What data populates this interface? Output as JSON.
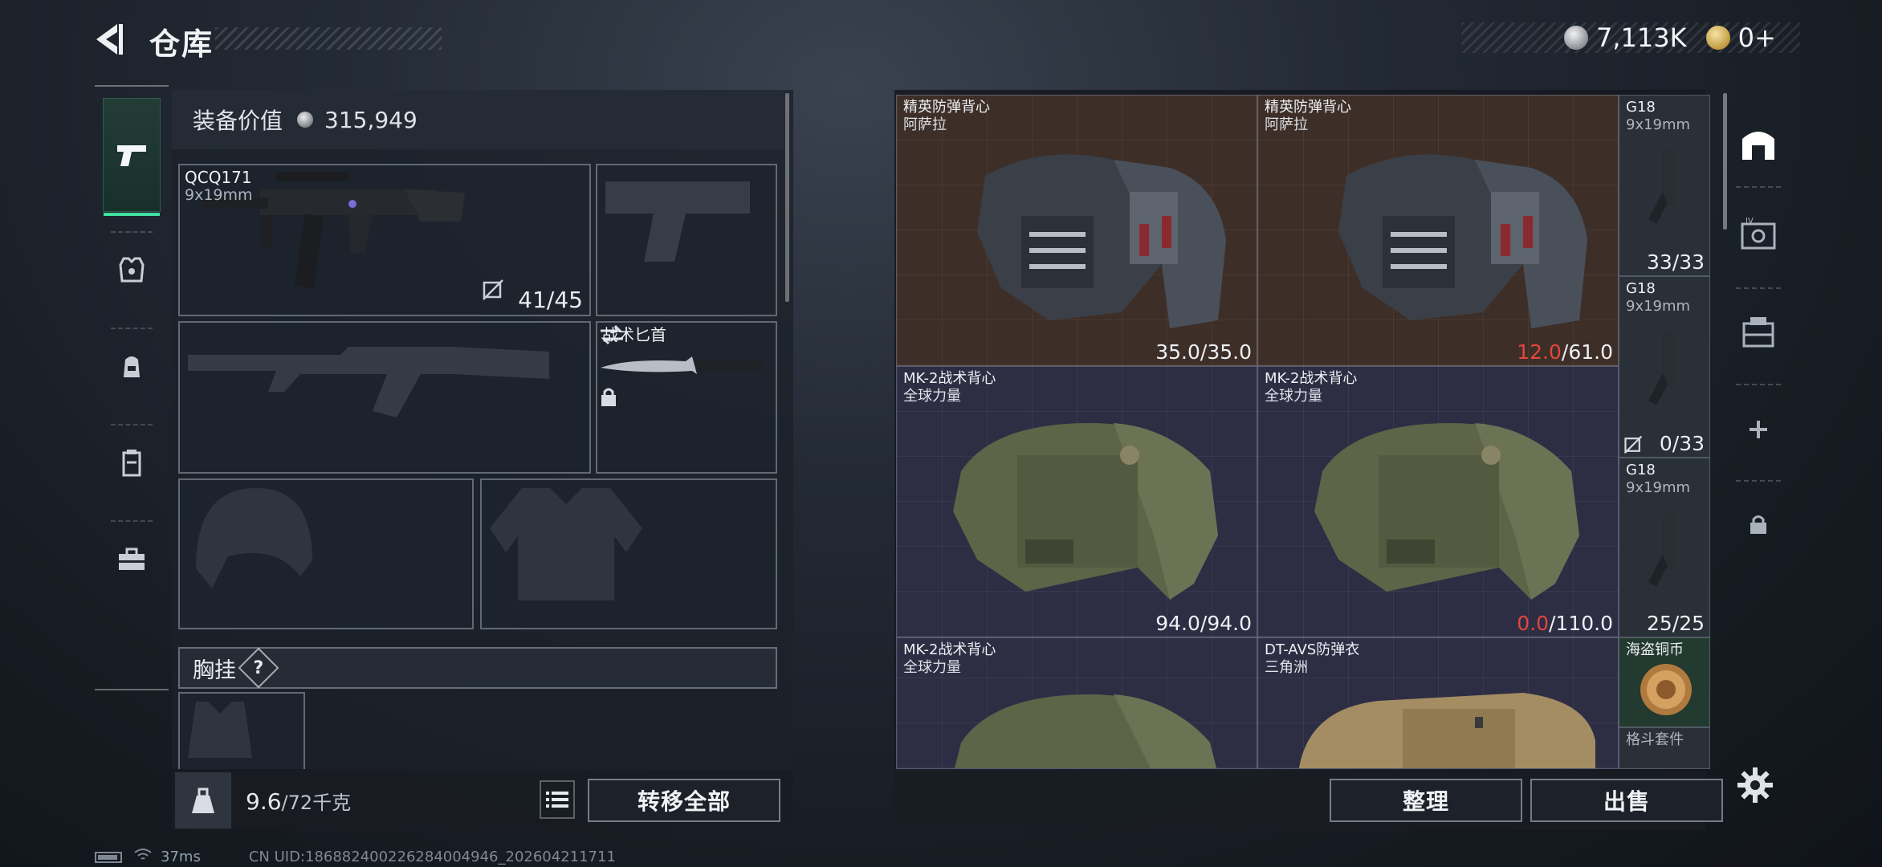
{
  "header": {
    "title": "仓库",
    "currency": [
      {
        "amount": "7,113K",
        "icon": "silver-coin-icon"
      },
      {
        "amount": "0+",
        "icon": "gold-coin-icon"
      }
    ]
  },
  "loadout": {
    "value_label": "装备价值",
    "value": "315,949",
    "primary_weapon": {
      "name": "QCQ171",
      "caliber": "9x19mm",
      "ammo": "41/45"
    },
    "melee": {
      "name": "战术匕首"
    },
    "chest_rig_label": "胸挂",
    "help_symbol": "?",
    "weight_current": "9.6",
    "weight_max": "/72千克",
    "transfer_all_label": "转移全部"
  },
  "stash": {
    "items": [
      {
        "name": "精英防弹背心",
        "brand": "阿萨拉",
        "durability_current": "35.0",
        "durability_max": "/35.0",
        "rarity": "brown"
      },
      {
        "name": "精英防弹背心",
        "brand": "阿萨拉",
        "durability_current": "12.0",
        "durability_max": "/61.0",
        "rarity": "brown",
        "damaged": true
      },
      {
        "name": "MK-2战术背心",
        "brand": "全球力量",
        "durability_current": "94.0",
        "durability_max": "/94.0",
        "rarity": "purple"
      },
      {
        "name": "MK-2战术背心",
        "brand": "全球力量",
        "durability_current": "0.0",
        "durability_max": "/110.0",
        "rarity": "purple",
        "damaged": true
      },
      {
        "name": "MK-2战术背心",
        "brand": "全球力量",
        "rarity": "purple"
      },
      {
        "name": "DT-AVS防弹衣",
        "brand": "三角洲",
        "rarity": "purple"
      }
    ],
    "side_items": [
      {
        "name": "G18",
        "caliber": "9x19mm",
        "ammo": "33/33"
      },
      {
        "name": "G18",
        "caliber": "9x19mm",
        "ammo": "0/33"
      },
      {
        "name": "G18",
        "caliber": "9x19mm",
        "ammo": "25/25"
      },
      {
        "name": "海盗铜币"
      },
      {
        "name": "格斗套件"
      }
    ],
    "sort_label": "整理",
    "sell_label": "出售"
  },
  "footer": {
    "ping": "37ms",
    "uid": "CN UID:186882400226284004946_202604211711"
  },
  "colors": {
    "accent_green": "#3fe0a0",
    "damaged_red": "#e2463c",
    "rarity_brown": "#3d2f28",
    "rarity_purple": "#2d2d44"
  }
}
